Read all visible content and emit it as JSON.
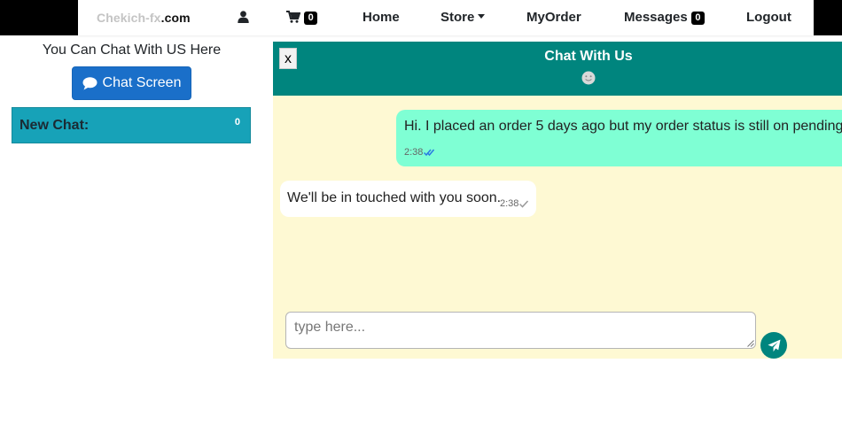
{
  "nav": {
    "brand_prefix": "Chekich-fx",
    "brand_suffix": ".com",
    "user_icon": "user-icon",
    "cart_icon": "cart-icon",
    "cart_count": "0",
    "home": "Home",
    "store": "Store",
    "myorder": "MyOrder",
    "messages": "Messages",
    "messages_count": "0",
    "logout": "Logout"
  },
  "left": {
    "title": "You Can Chat With US Here",
    "chat_button": "Chat Screen",
    "chat_button_icon": "comment-icon",
    "new_chat_label": "New Chat:",
    "new_chat_count": "0"
  },
  "chat": {
    "close_label": "x",
    "title": "Chat With Us",
    "status_icon": "smiley-icon",
    "messages": [
      {
        "direction": "outgoing",
        "text": "Hi. I placed an order 5 days ago but my order status is still on pending",
        "time": "2:38",
        "status": "read"
      },
      {
        "direction": "incoming",
        "text": "We'll be in touched with you soon.",
        "time": "2:38",
        "status": "sent"
      }
    ],
    "input_placeholder": "type here...",
    "input_value": "",
    "send_icon": "paper-plane-icon"
  },
  "colors": {
    "header_teal": "#00857e",
    "chat_bg": "#fef9d3",
    "outgoing_bubble": "#7fffd4",
    "incoming_bubble": "#ffffff",
    "new_chat_bg": "#17a2b8",
    "primary_button": "#1a6fc9"
  }
}
